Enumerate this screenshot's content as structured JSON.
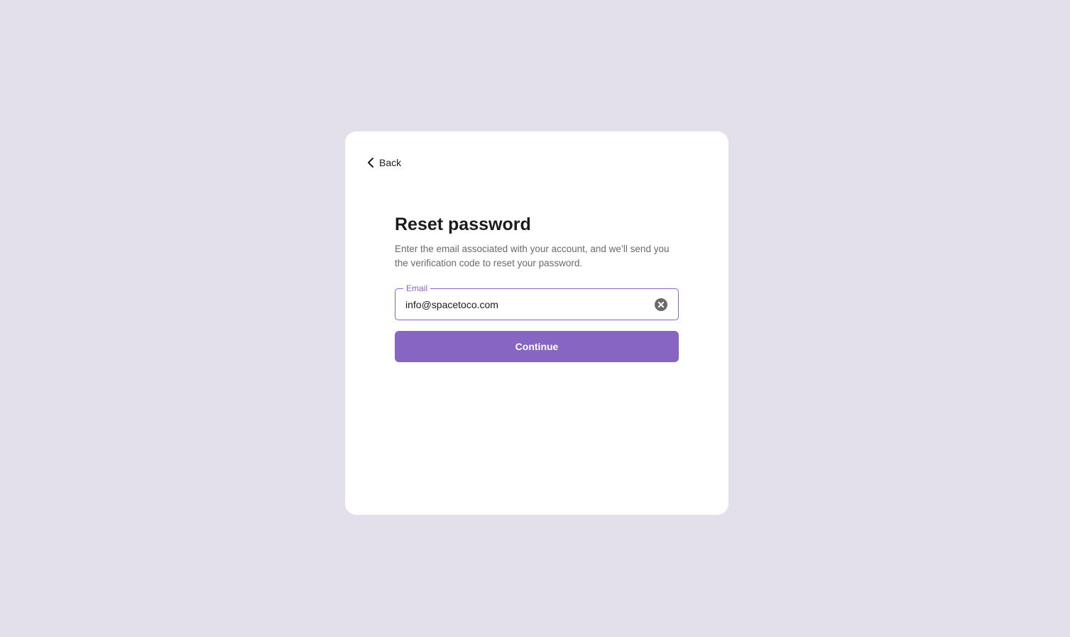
{
  "nav": {
    "back_label": "Back",
    "back_icon": "chevron-left-icon"
  },
  "form": {
    "title": "Reset password",
    "subtitle": "Enter the email associated with your account, and we’ll send you the verification code to reset your password.",
    "email": {
      "label": "Email",
      "value": "info@spacetoco.com",
      "clear_icon": "clear-circle-icon"
    },
    "continue_label": "Continue"
  },
  "colors": {
    "background": "#e3e0ec",
    "card": "#ffffff",
    "accent": "#8765c3",
    "text": "#1c1b1f",
    "muted": "#6b6870"
  }
}
